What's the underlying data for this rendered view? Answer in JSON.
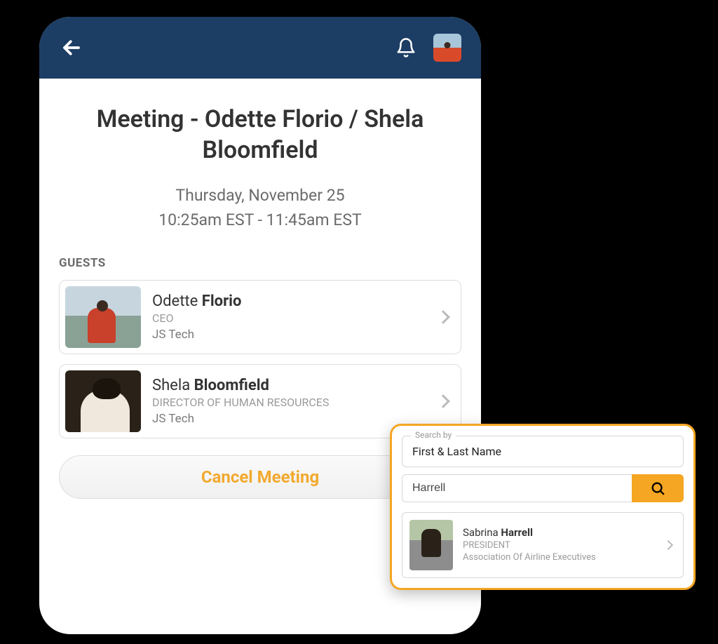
{
  "meeting": {
    "title": "Meeting - Odette Florio / Shela Bloomfield",
    "date": "Thursday, November 25",
    "time": "10:25am EST - 11:45am EST",
    "guests_label": "GUESTS",
    "cancel_label": "Cancel Meeting",
    "guests": [
      {
        "first": "Odette",
        "last": "Florio",
        "role": "CEO",
        "company": "JS Tech"
      },
      {
        "first": "Shela",
        "last": "Bloomfield",
        "role": "DIRECTOR OF HUMAN RESOURCES",
        "company": "JS Tech"
      }
    ]
  },
  "search": {
    "legend": "Search by",
    "mode": "First & Last Name",
    "query": "Harrell",
    "result": {
      "first": "Sabrina",
      "last": "Harrell",
      "role": "PRESIDENT",
      "org": "Association Of Airline Executives"
    }
  }
}
